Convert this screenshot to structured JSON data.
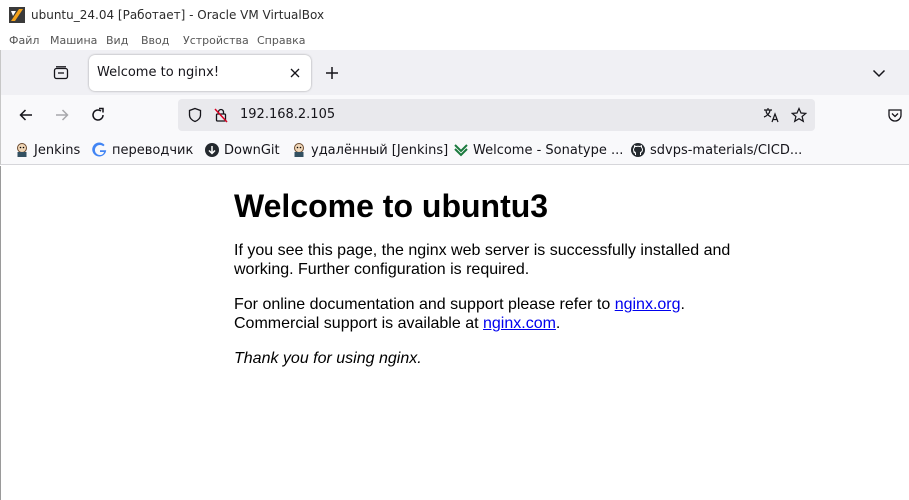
{
  "virtualbox": {
    "title": "ubuntu_24.04 [Работает] - Oracle VM VirtualBox",
    "menu": [
      "Файл",
      "Машина",
      "Вид",
      "Ввод",
      "Устройства",
      "Справка"
    ]
  },
  "browser": {
    "tab": {
      "title": "Welcome to nginx!"
    },
    "url": "192.168.2.105",
    "bookmarks": [
      {
        "label": "Jenkins",
        "icon": "jenkins-icon"
      },
      {
        "label": "переводчик",
        "icon": "google-icon"
      },
      {
        "label": "DownGit",
        "icon": "downgit-icon"
      },
      {
        "label": "удалённый [Jenkins]",
        "icon": "jenkins-icon"
      },
      {
        "label": "Welcome - Sonatype ...",
        "icon": "sonatype-icon"
      },
      {
        "label": "sdvps-materials/CICD...",
        "icon": "github-icon"
      }
    ]
  },
  "page": {
    "heading": "Welcome to ubuntu3",
    "p1": "If you see this page, the nginx web server is successfully installed and working. Further configuration is required.",
    "p2_before": "For online documentation and support please refer to ",
    "p2_link1": "nginx.org",
    "p2_mid": ".",
    "p2_line2": "Commercial support is available at ",
    "p2_link2": "nginx.com",
    "p2_end": ".",
    "p3": "Thank you for using nginx."
  },
  "colors": {
    "link": "#0000ee",
    "chrome": "#f0f0f4",
    "urlbar": "#e9e9ed"
  }
}
